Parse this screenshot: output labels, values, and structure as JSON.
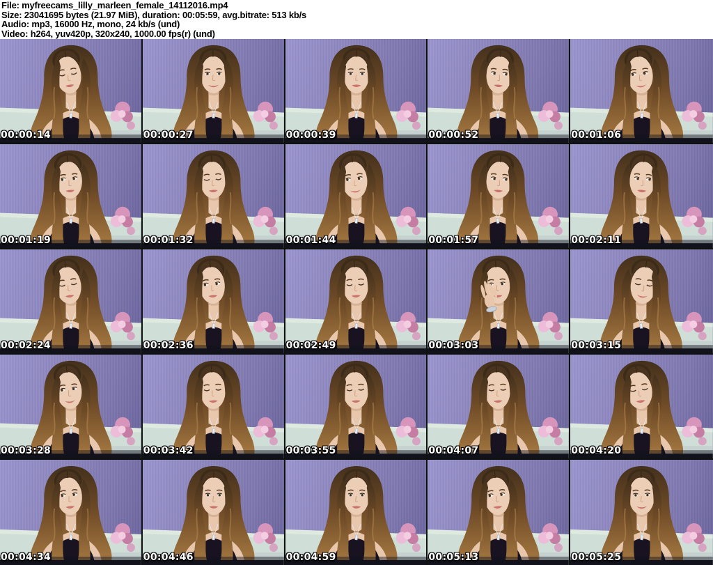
{
  "header": {
    "lines": [
      "File: myfreecams_lilly_marleen_female_14112016.mp4",
      "Size: 23041695 bytes (21.97 MiB), duration: 00:05:59, avg.bitrate: 513 kb/s",
      "Audio: mp3, 16000 Hz, mono, 24 kb/s (und)",
      "Video: h264, yuv420p, 320x240, 1000.00 fps(r) (und)"
    ]
  },
  "grid": {
    "rows": 5,
    "columns": 5
  },
  "thumbnails": [
    {
      "timestamp": "00:00:14",
      "pose": "down-left"
    },
    {
      "timestamp": "00:00:27",
      "pose": "front-smile"
    },
    {
      "timestamp": "00:00:39",
      "pose": "front"
    },
    {
      "timestamp": "00:00:52",
      "pose": "right"
    },
    {
      "timestamp": "00:01:06",
      "pose": "left-smile"
    },
    {
      "timestamp": "00:01:19",
      "pose": "left"
    },
    {
      "timestamp": "00:01:32",
      "pose": "down"
    },
    {
      "timestamp": "00:01:44",
      "pose": "left-smile"
    },
    {
      "timestamp": "00:01:57",
      "pose": "right"
    },
    {
      "timestamp": "00:02:11",
      "pose": "right"
    },
    {
      "timestamp": "00:02:24",
      "pose": "down-left"
    },
    {
      "timestamp": "00:02:36",
      "pose": "left"
    },
    {
      "timestamp": "00:02:49",
      "pose": "down"
    },
    {
      "timestamp": "00:03:03",
      "pose": "hand-up"
    },
    {
      "timestamp": "00:03:15",
      "pose": "down-right"
    },
    {
      "timestamp": "00:03:28",
      "pose": "left-smile"
    },
    {
      "timestamp": "00:03:42",
      "pose": "down"
    },
    {
      "timestamp": "00:03:55",
      "pose": "down"
    },
    {
      "timestamp": "00:04:07",
      "pose": "down"
    },
    {
      "timestamp": "00:04:20",
      "pose": "down-left"
    },
    {
      "timestamp": "00:04:34",
      "pose": "left"
    },
    {
      "timestamp": "00:04:46",
      "pose": "front"
    },
    {
      "timestamp": "00:04:59",
      "pose": "front"
    },
    {
      "timestamp": "00:05:13",
      "pose": "left"
    },
    {
      "timestamp": "00:05:25",
      "pose": "front-smile"
    }
  ],
  "colors": {
    "page_bg": "#ffffff",
    "header_text": "#000000",
    "wall_light": "#9b95cf",
    "wall": "#8781b8",
    "wall_dark": "#6b659e",
    "couch": "#cfdfd8",
    "couch_highlight": "#e0ebe0",
    "couch_shadow": "#b7c3c6",
    "hair_dark": "#43301c",
    "hair": "#6f4b27",
    "hair_light": "#a87b42",
    "hair_sheen": "#bb8d52",
    "skin": "#e8c7ac",
    "face_skin": "#eccdb5",
    "top": "#191321",
    "flower": "#d795bb",
    "flower_light": "#ecbcd8",
    "flower_dark": "#c57da4",
    "necklace": "#e6ecf2",
    "separator": "#0d120d",
    "bottom_band": "#12121c",
    "timestamp_text": "#ffffff",
    "timestamp_outline": "#000000"
  }
}
